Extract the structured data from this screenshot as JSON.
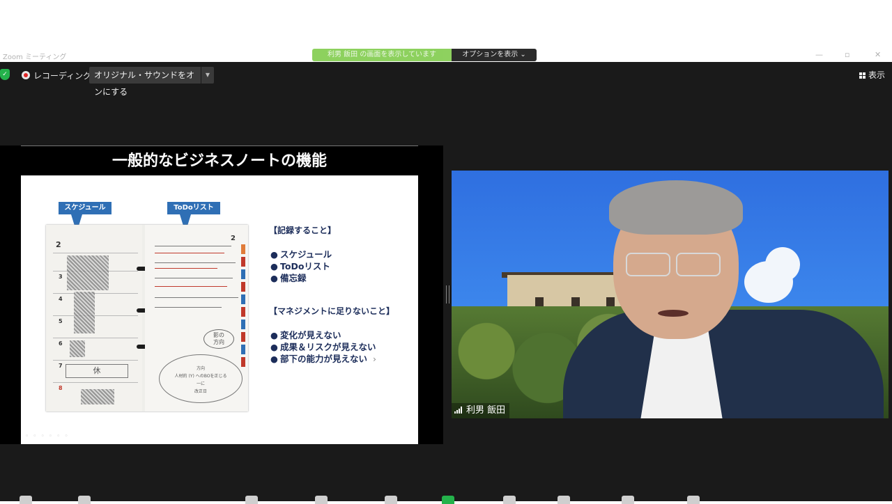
{
  "window": {
    "app_title": "Zoom ミーティング",
    "share_status": "利男 飯田 の画面を表示しています",
    "view_options_label": "オプションを表示",
    "minimize_glyph": "—",
    "maximize_glyph": "▫",
    "close_glyph": "✕"
  },
  "meeting_bar": {
    "recording_label": "レコーディング中",
    "original_sound_label": "オリジナル・サウンドをオンにする",
    "view_label": "表示"
  },
  "slide": {
    "title": "一般的なビジネスノートの機能",
    "callouts": {
      "schedule": "スケジュール",
      "todo": "ToDoリスト"
    },
    "notebook": {
      "left_page_numbers": [
        "2",
        "3",
        "4",
        "5",
        "6",
        "7",
        "8"
      ],
      "right_page_number": "2",
      "handwriting": [
        "休",
        "影の\n方向",
        "方向\n人材的 (Y) へのBOを正じる\n一に\n改正日"
      ]
    },
    "sections": [
      {
        "heading": "【記録すること】",
        "items": [
          "スケジュール",
          "ToDoリスト",
          "備忘録"
        ]
      },
      {
        "heading": "【マネジメントに足りないこと】",
        "items": [
          "変化が見えない",
          "成果＆リスクが見えない",
          "部下の能力が見えない"
        ]
      }
    ],
    "bullet_glyph": "●",
    "next_glyph": "›",
    "toolbar_glyphs": "◦◦◦◦◦◦"
  },
  "video": {
    "participant_name": "利男 飯田"
  },
  "colors": {
    "meeting_bg": "#1a1a1a",
    "recording_red": "#e02828",
    "shield_green": "#24b24b",
    "callout_blue": "#2f6fb5",
    "list_navy": "#1c2d5a"
  }
}
